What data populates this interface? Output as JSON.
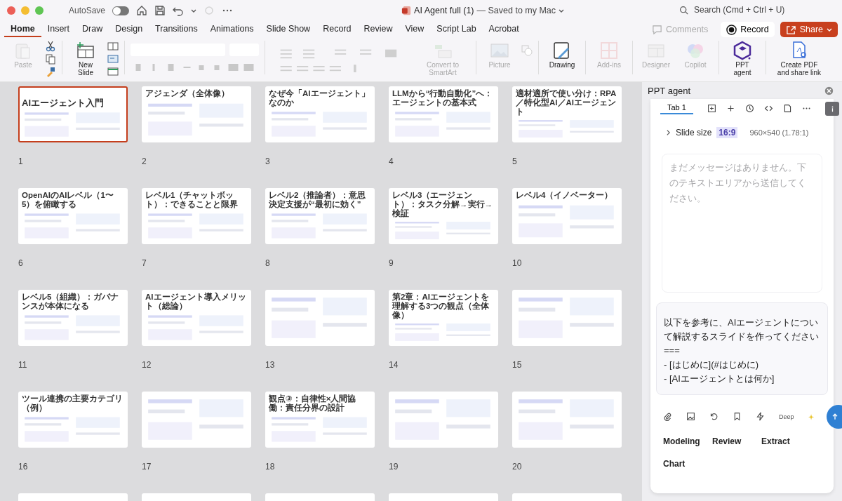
{
  "window": {
    "autosave_label": "AutoSave",
    "autosave_on": false,
    "title": "AI Agent full (1)",
    "save_status": "— Saved to my Mac",
    "search_placeholder": "Search (Cmd + Ctrl + U)"
  },
  "tabs": [
    {
      "label": "Home",
      "selected": true
    },
    {
      "label": "Insert",
      "selected": false
    },
    {
      "label": "Draw",
      "selected": false
    },
    {
      "label": "Design",
      "selected": false
    },
    {
      "label": "Transitions",
      "selected": false
    },
    {
      "label": "Animations",
      "selected": false
    },
    {
      "label": "Slide Show",
      "selected": false
    },
    {
      "label": "Record",
      "selected": false
    },
    {
      "label": "Review",
      "selected": false
    },
    {
      "label": "View",
      "selected": false
    },
    {
      "label": "Script Lab",
      "selected": false
    },
    {
      "label": "Acrobat",
      "selected": false
    }
  ],
  "actions": {
    "comments": {
      "label": "Comments",
      "disabled": true
    },
    "record": {
      "label": "Record"
    },
    "share": {
      "label": "Share"
    }
  },
  "ribbon": [
    {
      "kind": "paste",
      "label": "Paste",
      "disabled": true
    },
    {
      "kind": "new-slide",
      "label": "New Slide",
      "disabled": false
    },
    {
      "kind": "smartart",
      "label": "Convert to SmartArt",
      "disabled": true
    },
    {
      "kind": "picture",
      "label": "Picture",
      "disabled": true
    },
    {
      "kind": "drawing",
      "label": "Drawing",
      "disabled": false
    },
    {
      "kind": "addins",
      "label": "Add-ins",
      "disabled": true
    },
    {
      "kind": "designer",
      "label": "Designer",
      "disabled": true
    },
    {
      "kind": "copilot",
      "label": "Copilot",
      "disabled": true
    },
    {
      "kind": "agent",
      "label": "PPT agent",
      "disabled": false
    },
    {
      "kind": "pdf",
      "label": "Create PDF and share link",
      "disabled": false
    }
  ],
  "slides": [
    {
      "number": "1",
      "title": "AIエージェント入門",
      "selected": true
    },
    {
      "number": "2",
      "title": "アジェンダ（全体像）",
      "selected": false
    },
    {
      "number": "3",
      "title": "なぜ今「AIエージェント」なのか",
      "selected": false
    },
    {
      "number": "4",
      "title": "LLMから“行動自動化”へ：エージェントの基本式",
      "selected": false
    },
    {
      "number": "5",
      "title": "適材適所で使い分け：RPA／特化型AI／AIエージェント",
      "selected": false
    },
    {
      "number": "6",
      "title": "OpenAIのAIレベル（1〜5）を俯瞰する",
      "selected": false
    },
    {
      "number": "7",
      "title": "レベル1（チャットボット）：できることと限界",
      "selected": false
    },
    {
      "number": "8",
      "title": "レベル2（推論者）：意思決定支援が“最初に効く”",
      "selected": false
    },
    {
      "number": "9",
      "title": "レベル3（エージェント）：タスク分解→実行→検証",
      "selected": false
    },
    {
      "number": "10",
      "title": "レベル4（イノベーター）",
      "selected": false
    },
    {
      "number": "11",
      "title": "レベル5（組織）：ガバナンスが本体になる",
      "selected": false
    },
    {
      "number": "12",
      "title": "AIエージェント導入メリット（総論）",
      "selected": false
    },
    {
      "number": "13",
      "selected": false
    },
    {
      "number": "14",
      "title": "第2章：AIエージェントを理解する3つの観点（全体像）",
      "selected": false
    },
    {
      "number": "15",
      "selected": false
    },
    {
      "number": "16",
      "title": "ツール連携の主要カテゴリ（例）",
      "selected": false
    },
    {
      "number": "17",
      "selected": false
    },
    {
      "number": "18",
      "title": "観点③：自律性×人間協働：責任分界の設計",
      "selected": false
    },
    {
      "number": "19",
      "selected": false
    },
    {
      "number": "20",
      "selected": false
    }
  ],
  "panel": {
    "title": "PPT agent",
    "tab": "Tab 1",
    "slide_size_label": "Slide size",
    "ratio": "16:9",
    "dimensions": "960×540 (1.78:1)",
    "empty_message": "まだメッセージはありません。下のテキストエリアから送信してください。",
    "prompt": "以下を参考に、AIエージェントについて解説するスライドを作ってください\n===\n- [はじめに](#はじめに)\n- [AIエージェントとは何か]",
    "mode": "Deep",
    "quick_actions": [
      "Modeling",
      "Review",
      "Extract",
      "Chart"
    ]
  }
}
